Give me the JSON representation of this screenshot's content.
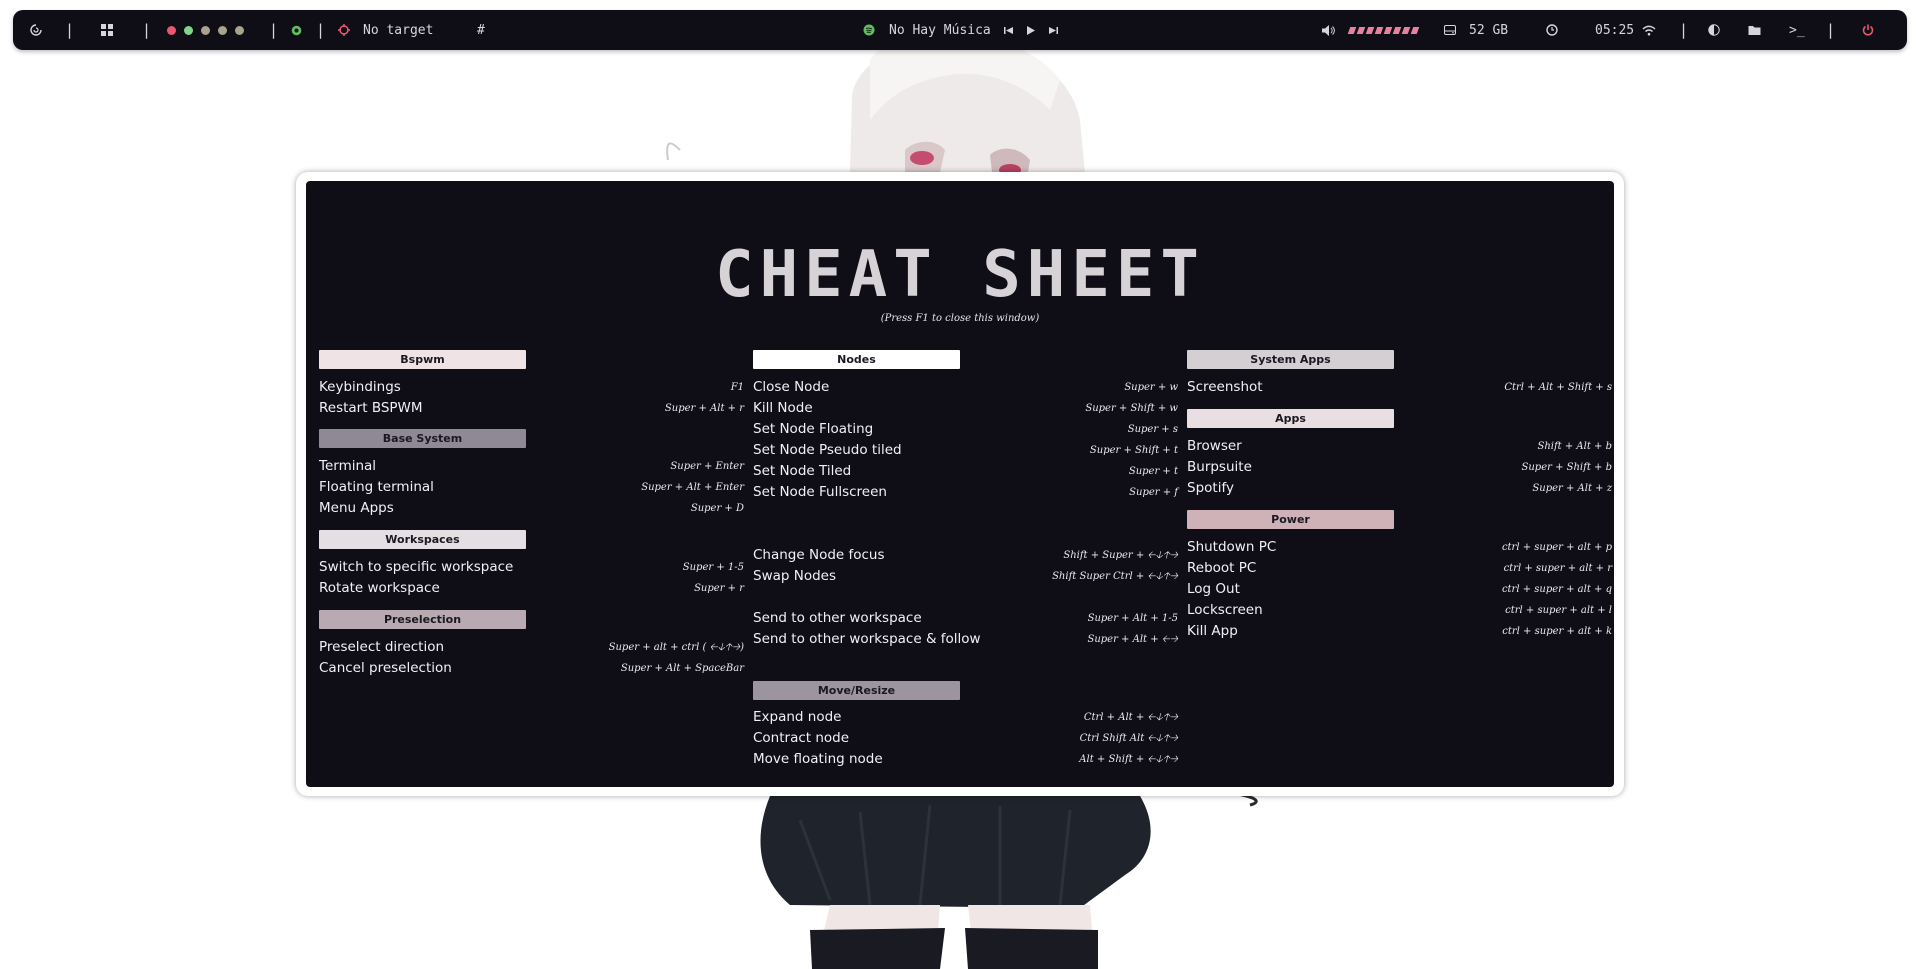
{
  "topbar": {
    "player_text": "No Hay Música",
    "target_text": "No target",
    "hash_label": "#",
    "disk_text": "52 GB",
    "clock_text": "05:25",
    "workspace_dots": [
      "#e8576b",
      "#7fd48a",
      "#a9a28c",
      "#a9a28c",
      "#a9a28c"
    ],
    "volume_segments": 8,
    "accent_pink": "#e8819f"
  },
  "window": {
    "banner_text": "CHEAT SHEET",
    "close_hint": "(Press F1 to close this window)"
  },
  "sections": {
    "bspwm": {
      "title": "Bspwm",
      "color": "#efe3e6",
      "rows": [
        {
          "label": "Keybindings",
          "keys": "F1"
        },
        {
          "label": "Restart BSPWM",
          "keys": "Super + Alt + r"
        }
      ]
    },
    "base_system": {
      "title": "Base System",
      "color": "#8f8995",
      "rows": [
        {
          "label": "Terminal",
          "keys": "Super + Enter"
        },
        {
          "label": "Floating terminal",
          "keys": "Super + Alt + Enter"
        },
        {
          "label": "Menu Apps",
          "keys": "Super + D"
        }
      ]
    },
    "workspaces": {
      "title": "Workspaces",
      "color": "#e4dfe3",
      "rows": [
        {
          "label": "Switch to specific workspace",
          "keys": "Super + 1-5"
        },
        {
          "label": "Rotate workspace",
          "keys": "Super + r"
        }
      ]
    },
    "preselection": {
      "title": "Preselection",
      "color": "#b9a9b0",
      "rows": [
        {
          "label": "Preselect direction",
          "keys": "Super + alt + ctrl ( 🡠🡣🡡🡢)"
        },
        {
          "label": "Cancel preselection",
          "keys": "Super + Alt + SpaceBar"
        }
      ]
    },
    "nodes": {
      "title": "Nodes",
      "color": "#ffffff",
      "rows": [
        {
          "label": "Close Node",
          "keys": "Super + w"
        },
        {
          "label": "Kill Node",
          "keys": "Super + Shift + w"
        },
        {
          "label": "Set Node Floating",
          "keys": "Super + s"
        },
        {
          "label": "Set Node Pseudo tiled",
          "keys": "Super + Shift + t"
        },
        {
          "label": "Set Node Tiled",
          "keys": "Super + t"
        },
        {
          "label": "Set Node Fullscreen",
          "keys": "Super + f"
        }
      ],
      "rows_focus": [
        {
          "label": "Change Node focus",
          "keys": "Shift + Super + 🡠🡣🡡🡢"
        },
        {
          "label": "Swap Nodes",
          "keys": "Shift Super Ctrl + 🡠🡣🡡🡢"
        }
      ],
      "rows_send": [
        {
          "label": "Send to other workspace",
          "keys": "Super + Alt + 1-5"
        },
        {
          "label": "Send to other workspace & follow",
          "keys": "Super + Alt + 🡠🡢"
        }
      ]
    },
    "move_resize": {
      "title": "Move/Resize",
      "color": "#9d959d",
      "rows": [
        {
          "label": "Expand node",
          "keys": "Ctrl + Alt + 🡠🡣🡡🡢"
        },
        {
          "label": "Contract node",
          "keys": "Ctrl Shift Alt 🡠🡣🡡🡢"
        },
        {
          "label": "Move floating node",
          "keys": "Alt + Shift + 🡠🡣🡡🡢"
        }
      ]
    },
    "system_apps": {
      "title": "System Apps",
      "color": "#d4cfd3",
      "rows": [
        {
          "label": "Screenshot",
          "keys": "Ctrl + Alt + Shift + s"
        }
      ]
    },
    "apps": {
      "title": "Apps",
      "color": "#e9dfe2",
      "rows": [
        {
          "label": "Browser",
          "keys": "Shift + Alt + b"
        },
        {
          "label": "Burpsuite",
          "keys": "Super + Shift + b"
        },
        {
          "label": "Spotify",
          "keys": "Super + Alt + z"
        }
      ]
    },
    "power": {
      "title": "Power",
      "color": "#cfb1b8",
      "rows": [
        {
          "label": "Shutdown PC",
          "keys": "ctrl + super + alt + p"
        },
        {
          "label": "Reboot PC",
          "keys": "ctrl + super + alt + r"
        },
        {
          "label": "Log Out",
          "keys": "ctrl + super + alt + q"
        },
        {
          "label": "Lockscreen",
          "keys": "ctrl + super + alt + l"
        },
        {
          "label": "Kill App",
          "keys": "ctrl + super + alt + k"
        }
      ]
    }
  }
}
